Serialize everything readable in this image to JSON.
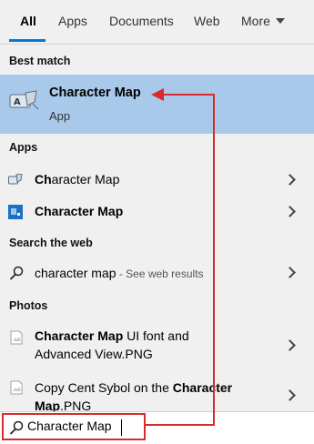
{
  "tabs": {
    "all": "All",
    "apps": "Apps",
    "documents": "Documents",
    "web": "Web",
    "more": "More"
  },
  "best_match": {
    "header": "Best match",
    "title": "Character Map",
    "subtitle": "App"
  },
  "apps": {
    "header": "Apps",
    "items": [
      {
        "bold": "Ch",
        "rest": "aracter Map"
      },
      {
        "bold": "Character Map",
        "rest": ""
      }
    ]
  },
  "web": {
    "header": "Search the web",
    "query": "character map",
    "suffix": " - See web results"
  },
  "photos": {
    "header": "Photos",
    "items": [
      {
        "bold": "Character Map",
        "line1_rest": " UI font and",
        "line2": "Advanced View.PNG"
      },
      {
        "line1_pre": "Copy Cent Sybol on the ",
        "bold": "Character",
        "line2_bold": "Map",
        "line2_rest": ".PNG"
      }
    ]
  },
  "search": {
    "value": "Character Map"
  },
  "colors": {
    "accent": "#0078d7",
    "selection": "#a9c9eb",
    "annotation_red": "#d92b2b"
  }
}
